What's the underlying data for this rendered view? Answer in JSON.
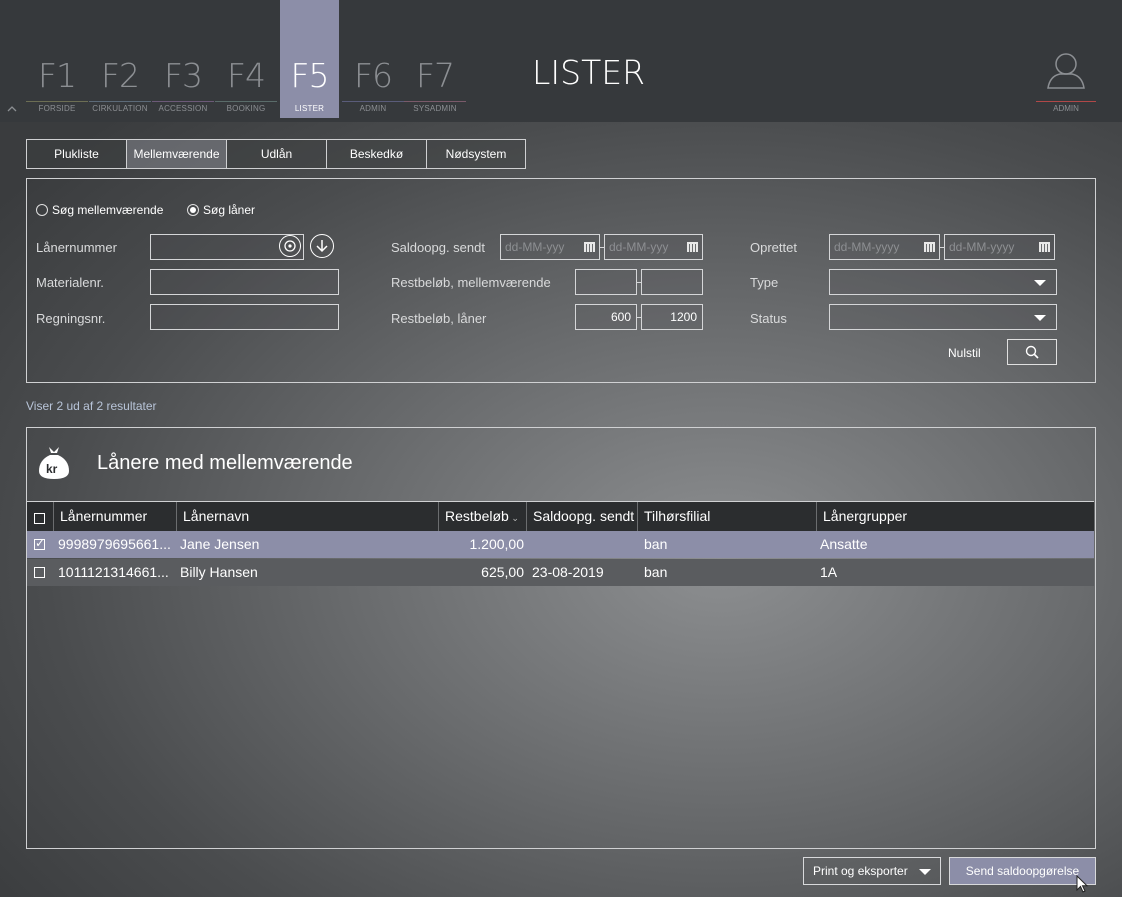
{
  "nav": {
    "keys": [
      {
        "key": "F1",
        "label": "FORSIDE"
      },
      {
        "key": "F2",
        "label": "CIRKULATION"
      },
      {
        "key": "F3",
        "label": "ACCESSION"
      },
      {
        "key": "F4",
        "label": "BOOKING"
      },
      {
        "key": "F5",
        "label": "LISTER"
      },
      {
        "key": "F6",
        "label": "ADMIN"
      },
      {
        "key": "F7",
        "label": "SYSADMIN"
      }
    ],
    "active": "F5",
    "page_title": "LISTER",
    "user_label": "ADMIN"
  },
  "tabs": [
    "Plukliste",
    "Mellemværende",
    "Udlån",
    "Beskedkø",
    "Nødsystem"
  ],
  "active_tab": "Mellemværende",
  "filter": {
    "radio_mellem": "Søg mellemværende",
    "radio_laaner": "Søg låner",
    "radio_selected": "Søg låner",
    "laanernummer_label": "Lånernummer",
    "laanernummer_value": "",
    "materialenr_label": "Materialenr.",
    "materialenr_value": "",
    "regningsnr_label": "Regningsnr.",
    "regningsnr_value": "",
    "saldo_label": "Saldoopg. sendt",
    "saldo_from_placeholder": "dd-MM-yyy",
    "saldo_to_placeholder": "dd-MM-yyy",
    "rest_mellem_label": "Restbeløb, mellemværende",
    "rest_mellem_from": "",
    "rest_mellem_to": "",
    "rest_laaner_label": "Restbeløb, låner",
    "rest_laaner_from": "600",
    "rest_laaner_to": "1200",
    "oprettet_label": "Oprettet",
    "oprettet_from_placeholder": "dd-MM-yyyy",
    "oprettet_to_placeholder": "dd-MM-yyyy",
    "type_label": "Type",
    "type_value": "",
    "status_label": "Status",
    "status_value": "",
    "reset_label": "Nulstil"
  },
  "result_count": "Viser 2 ud af 2 resultater",
  "results": {
    "title": "Lånere med mellemværende",
    "icon_text": "kr",
    "columns": [
      "Lånernummer",
      "Lånernavn",
      "Restbeløb",
      "Saldoopg. sendt",
      "Tilhørsfilial",
      "Lånergrupper"
    ],
    "rows": [
      {
        "checked": true,
        "nummer": "9998979695661...",
        "navn": "Jane Jensen",
        "rest": "1.200,00",
        "saldo": "",
        "filial": "ban",
        "gruppe": "Ansatte"
      },
      {
        "checked": false,
        "nummer": "1011121314661...",
        "navn": "Billy Hansen",
        "rest": "625,00",
        "saldo": "23-08-2019",
        "filial": "ban",
        "gruppe": "1A"
      }
    ]
  },
  "actions": {
    "export_label": "Print og eksporter",
    "send_label": "Send saldoopgørelse"
  },
  "colors": {
    "accent": "#8c8ea8",
    "user_line": "#b04848",
    "topbar": "#36393c"
  }
}
